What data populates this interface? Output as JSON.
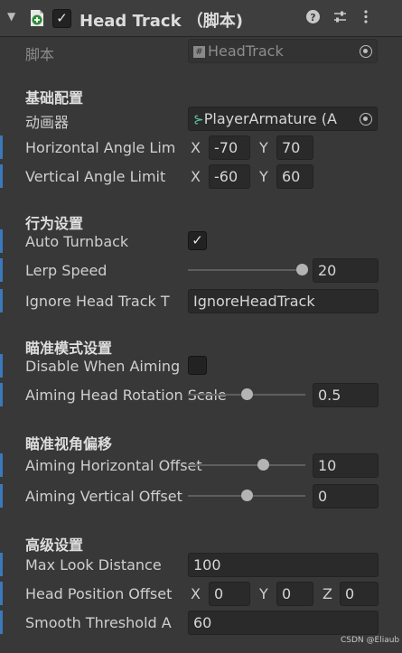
{
  "header": {
    "title": "Head Track （脚本)",
    "enabled": true,
    "help_icon": "help-icon",
    "settings_icon": "presets-icon",
    "menu_icon": "kebab-menu-icon"
  },
  "script": {
    "label": "脚本",
    "value": "HeadTrack"
  },
  "sections": {
    "basic": "基础配置",
    "behavior": "行为设置",
    "aim_mode": "瞄准模式设置",
    "aim_offset": "瞄准视角偏移",
    "advanced": "高级设置"
  },
  "fields": {
    "animator": {
      "label": "动画器",
      "value": "PlayerArmature (A"
    },
    "horizontal_limit": {
      "label": "Horizontal Angle Lim",
      "x_label": "X",
      "x": "-70",
      "y_label": "Y",
      "y": "70"
    },
    "vertical_limit": {
      "label": "Vertical Angle Limit",
      "x_label": "X",
      "x": "-60",
      "y_label": "Y",
      "y": "60"
    },
    "auto_turnback": {
      "label": "Auto Turnback",
      "checked": true
    },
    "lerp_speed": {
      "label": "Lerp Speed",
      "value": "20",
      "slider_fraction": 0.97
    },
    "ignore_tag": {
      "label": "Ignore Head Track T",
      "value": "IgnoreHeadTrack"
    },
    "disable_when_aiming": {
      "label": "Disable When Aiming",
      "checked": false
    },
    "aim_rotation_scale": {
      "label": "Aiming Head Rotation Scale",
      "value": "0.5",
      "slider_fraction": 0.5
    },
    "aim_h_offset": {
      "label": "Aiming Horizontal Offset",
      "value": "10",
      "slider_fraction": 0.64
    },
    "aim_v_offset": {
      "label": "Aiming Vertical Offset",
      "value": "0",
      "slider_fraction": 0.5
    },
    "max_look_distance": {
      "label": "Max Look Distance",
      "value": "100"
    },
    "head_position_offset": {
      "label": "Head Position Offset",
      "x_label": "X",
      "x": "0",
      "y_label": "Y",
      "y": "0",
      "z_label": "Z",
      "z": "0"
    },
    "smooth_threshold": {
      "label": "Smooth Threshold A",
      "value": "60"
    }
  },
  "watermark": "CSDN @Eliaub",
  "colors": {
    "accent_bar": "#3a79bb",
    "background": "#383838",
    "field": "#2a2a2a"
  }
}
